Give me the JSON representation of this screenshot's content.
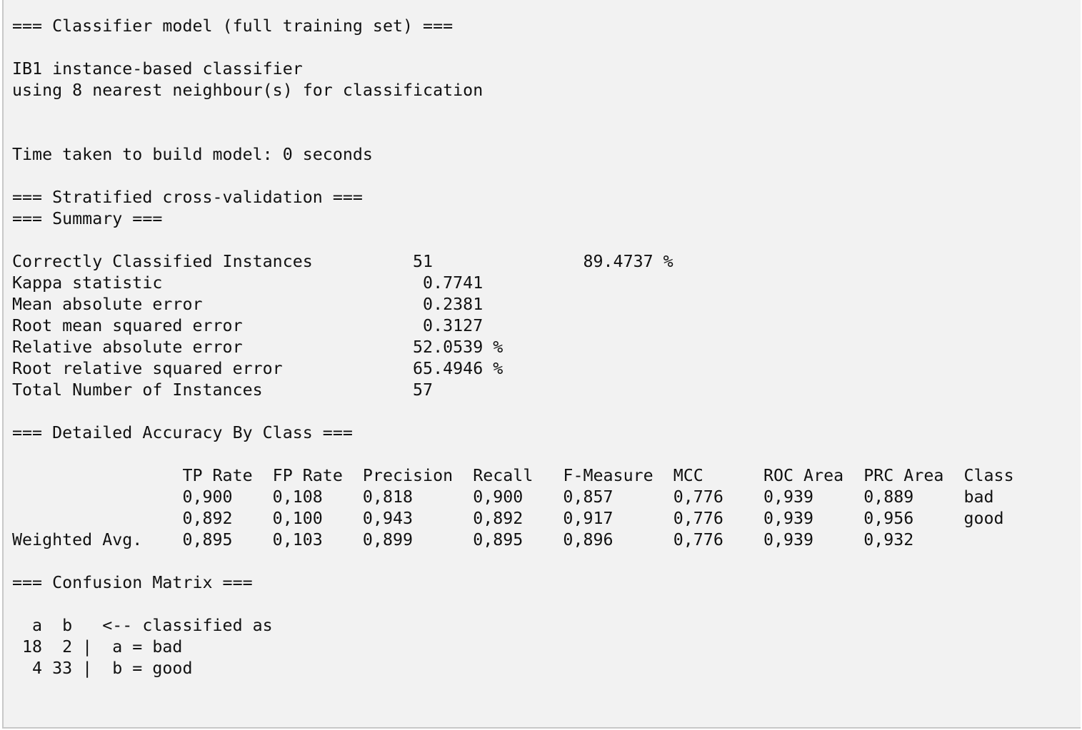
{
  "output": {
    "lines": [
      "=== Classifier model (full training set) ===",
      "",
      "IB1 instance-based classifier",
      "using 8 nearest neighbour(s) for classification",
      "",
      "",
      "Time taken to build model: 0 seconds",
      "",
      "=== Stratified cross-validation ===",
      "=== Summary ===",
      "",
      "Correctly Classified Instances          51               89.4737 %",
      "Kappa statistic                          0.7741",
      "Mean absolute error                      0.2381",
      "Root mean squared error                  0.3127",
      "Relative absolute error                 52.0539 %",
      "Root relative squared error             65.4946 %",
      "Total Number of Instances               57",
      "",
      "=== Detailed Accuracy By Class ===",
      "",
      "                 TP Rate  FP Rate  Precision  Recall   F-Measure  MCC      ROC Area  PRC Area  Class",
      "                 0,900    0,108    0,818      0,900    0,857      0,776    0,939     0,889     bad",
      "                 0,892    0,100    0,943      0,892    0,917      0,776    0,939     0,956     good",
      "Weighted Avg.    0,895    0,103    0,899      0,895    0,896      0,776    0,939     0,932",
      "",
      "=== Confusion Matrix ===",
      "",
      "  a  b   <-- classified as",
      " 18  2 |  a = bad",
      "  4 33 |  b = good"
    ]
  }
}
